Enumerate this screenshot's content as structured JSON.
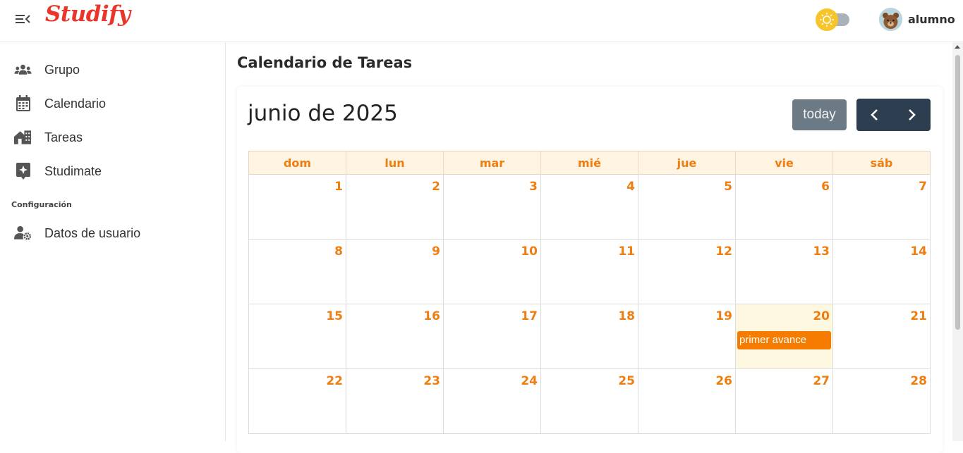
{
  "app": {
    "brand": "Studify",
    "user_name": "alumno"
  },
  "icons": {
    "menu": "menu-collapse-icon",
    "theme": "sun-icon",
    "avatar": "bear-avatar",
    "group": "users-icon",
    "calendar": "calendar-icon",
    "tasks": "house-tasks-icon",
    "studimate": "sparkle-icon",
    "user_settings": "user-gear-icon",
    "prev": "chevron-left-icon",
    "next": "chevron-right-icon"
  },
  "colors": {
    "brand": "#e8362b",
    "accent": "#f07d10",
    "event": "#f57c00",
    "nav_dark": "#2c3e50",
    "today_btn": "#6c7a85"
  },
  "sidebar": {
    "items": [
      {
        "label": "Grupo"
      },
      {
        "label": "Calendario"
      },
      {
        "label": "Tareas"
      },
      {
        "label": "Studimate"
      }
    ],
    "section_title": "Configuración",
    "settings_items": [
      {
        "label": "Datos de usuario"
      }
    ]
  },
  "main": {
    "page_title": "Calendario de Tareas",
    "calendar": {
      "title": "junio de 2025",
      "today_label": "today",
      "weekdays": [
        "dom",
        "lun",
        "mar",
        "mié",
        "jue",
        "vie",
        "sáb"
      ],
      "weeks": [
        [
          "1",
          "2",
          "3",
          "4",
          "5",
          "6",
          "7"
        ],
        [
          "8",
          "9",
          "10",
          "11",
          "12",
          "13",
          "14"
        ],
        [
          "15",
          "16",
          "17",
          "18",
          "19",
          "20",
          "21"
        ],
        [
          "22",
          "23",
          "24",
          "25",
          "26",
          "27",
          "28"
        ]
      ],
      "highlighted_day": "20",
      "events": [
        {
          "day": "20",
          "title": "primer avance"
        }
      ]
    }
  }
}
